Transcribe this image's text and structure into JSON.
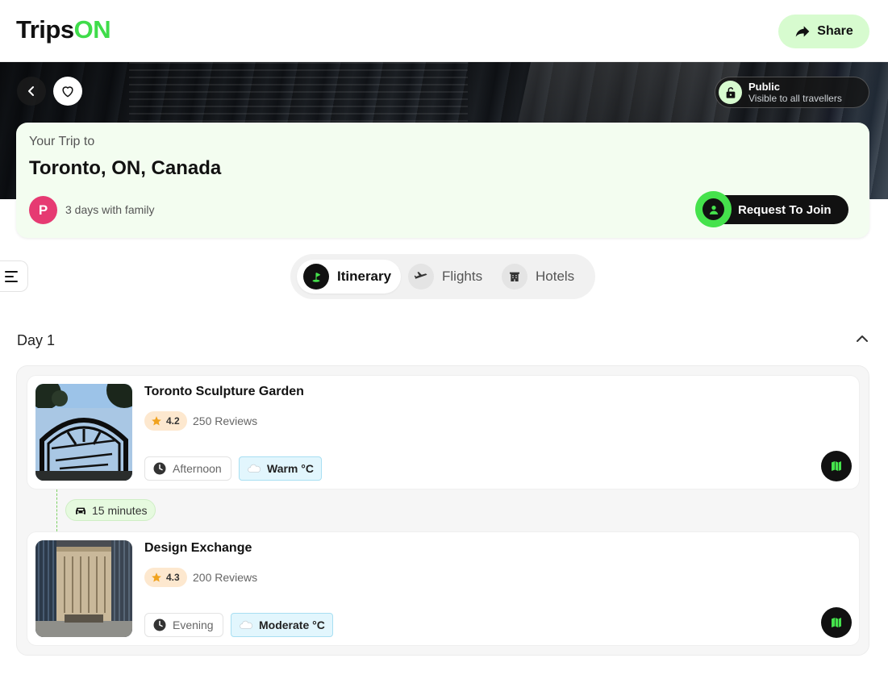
{
  "header": {
    "logo_part1": "Trips",
    "logo_part2": "ON",
    "share_label": "Share"
  },
  "hero": {
    "visibility_title": "Public",
    "visibility_sub": "Visible to all travellers"
  },
  "trip": {
    "subtitle": "Your Trip to",
    "destination": "Toronto, ON, Canada",
    "avatar_initial": "P",
    "meta": "3 days with family",
    "join_label": "Request To Join"
  },
  "tabs": [
    {
      "label": "Itinerary",
      "icon": "itinerary-icon",
      "active": true
    },
    {
      "label": "Flights",
      "icon": "plane-icon",
      "active": false
    },
    {
      "label": "Hotels",
      "icon": "hotel-icon",
      "active": false
    }
  ],
  "day": {
    "title": "Day 1",
    "places": [
      {
        "name": "Toronto Sculpture Garden",
        "rating": "4.2",
        "reviews": "250 Reviews",
        "time": "Afternoon",
        "weather": "Warm °C"
      },
      {
        "name": "Design Exchange",
        "rating": "4.3",
        "reviews": "200 Reviews",
        "time": "Evening",
        "weather": "Moderate °C"
      }
    ],
    "travel": "15 minutes"
  },
  "colors": {
    "brand_green": "#3fdc4a",
    "share_bg": "#d7fbcf",
    "trip_card_bg": "#f3fdf0",
    "avatar_bg": "#e63a72",
    "rating_bg": "#fde8cf",
    "weather_bg": "#e2f6fd"
  }
}
